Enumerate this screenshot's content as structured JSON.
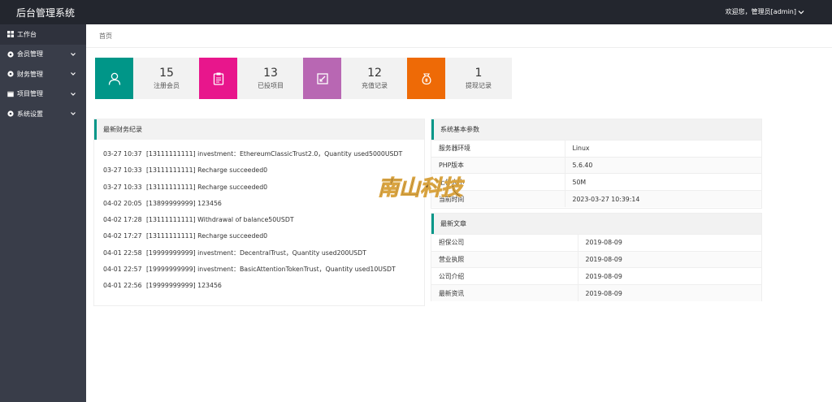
{
  "app": {
    "title": "后台管理系统",
    "user_greeting": "欢迎您，管理员[admin]"
  },
  "sidebar": {
    "items": [
      {
        "label": "工作台",
        "icon": "dashboard-icon",
        "has_arrow": false
      },
      {
        "label": "会员管理",
        "icon": "gear-icon",
        "has_arrow": true
      },
      {
        "label": "财务管理",
        "icon": "gear-icon",
        "has_arrow": true
      },
      {
        "label": "项目管理",
        "icon": "box-icon",
        "has_arrow": true
      },
      {
        "label": "系统设置",
        "icon": "gear-icon",
        "has_arrow": true
      }
    ]
  },
  "breadcrumb": "首页",
  "stats": [
    {
      "value": "15",
      "label": "注册会员",
      "color": "#009688",
      "icon": "user-icon"
    },
    {
      "value": "13",
      "label": "已投项目",
      "color": "#e8168c",
      "icon": "clipboard-icon"
    },
    {
      "value": "12",
      "label": "充值记录",
      "color": "#b867b3",
      "icon": "edit-icon"
    },
    {
      "value": "1",
      "label": "提现记录",
      "color": "#ee6a06",
      "icon": "money-bag-icon"
    }
  ],
  "finance": {
    "title": "最新财务纪录",
    "rows": [
      {
        "time": "03-27 10:37",
        "text": "[13111111111] investment：EthereumClassicTrust2.0，Quantity used5000USDT"
      },
      {
        "time": "03-27 10:33",
        "text": "[13111111111] Recharge succeeded0"
      },
      {
        "time": "03-27 10:33",
        "text": "[13111111111] Recharge succeeded0"
      },
      {
        "time": "04-02 20:05",
        "text": "[13899999999] 123456"
      },
      {
        "time": "04-02 17:28",
        "text": "[13111111111] Withdrawal of balance50USDT"
      },
      {
        "time": "04-02 17:27",
        "text": "[13111111111] Recharge succeeded0"
      },
      {
        "time": "04-01 22:58",
        "text": "[19999999999] investment：DecentralTrust，Quantity used200USDT"
      },
      {
        "time": "04-01 22:57",
        "text": "[19999999999] investment：BasicAttentionTokenTrust，Quantity used10USDT"
      },
      {
        "time": "04-01 22:56",
        "text": "[19999999999] 123456"
      }
    ]
  },
  "system": {
    "title": "系统基本参数",
    "rows": [
      {
        "key": "服务器环境",
        "value": "Linux"
      },
      {
        "key": "PHP版本",
        "value": "5.6.40"
      },
      {
        "key": "上传大小",
        "value": "50M"
      },
      {
        "key": "当前时间",
        "value": "2023-03-27 10:39:14"
      }
    ]
  },
  "articles": {
    "title": "最新文章",
    "rows": [
      {
        "key": "担保公司",
        "value": "2019-08-09"
      },
      {
        "key": "营业执照",
        "value": "2019-08-09"
      },
      {
        "key": "公司介绍",
        "value": "2019-08-09"
      },
      {
        "key": "最新资讯",
        "value": "2019-08-09"
      }
    ]
  },
  "watermark": {
    "text": "南山科技"
  }
}
